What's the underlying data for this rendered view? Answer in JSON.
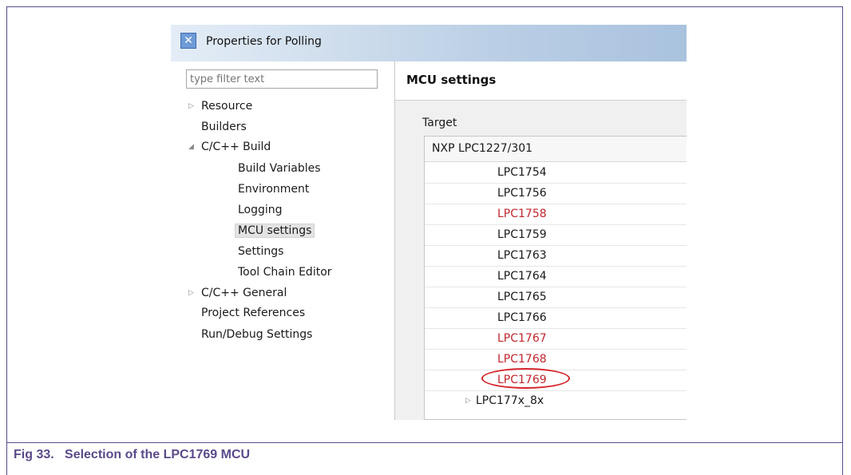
{
  "window": {
    "title": "Properties for Polling",
    "icon": "eclipse-app-icon"
  },
  "filter": {
    "placeholder": "type filter text"
  },
  "tree": {
    "items": [
      {
        "label": "Resource",
        "expander": "collapsed"
      },
      {
        "label": "Builders"
      },
      {
        "label": "C/C++ Build",
        "expander": "expanded"
      },
      {
        "label": "Build Variables"
      },
      {
        "label": "Environment"
      },
      {
        "label": "Logging"
      },
      {
        "label": "MCU settings",
        "selected": true
      },
      {
        "label": "Settings"
      },
      {
        "label": "Tool Chain Editor"
      },
      {
        "label": "C/C++ General",
        "expander": "collapsed"
      },
      {
        "label": "Project References"
      },
      {
        "label": "Run/Debug Settings"
      }
    ]
  },
  "right": {
    "title": "MCU settings",
    "target_label": "Target",
    "list_header": "NXP LPC1227/301",
    "rows": [
      {
        "label": "LPC1754",
        "color": "#1a1a1a"
      },
      {
        "label": "LPC1756",
        "color": "#1a1a1a"
      },
      {
        "label": "LPC1758",
        "color": "#c0272d"
      },
      {
        "label": "LPC1759",
        "color": "#1a1a1a"
      },
      {
        "label": "LPC1763",
        "color": "#1a1a1a"
      },
      {
        "label": "LPC1764",
        "color": "#1a1a1a"
      },
      {
        "label": "LPC1765",
        "color": "#1a1a1a"
      },
      {
        "label": "LPC1766",
        "color": "#1a1a1a"
      },
      {
        "label": "LPC1767",
        "color": "#c0272d"
      },
      {
        "label": "LPC1768",
        "color": "#c0272d"
      },
      {
        "label": "LPC1769",
        "color": "#c0272d",
        "highlighted": true
      },
      {
        "label": "LPC177x_8x",
        "expander": "collapsed"
      }
    ]
  },
  "caption": "Fig 33.   Selection of the LPC1769 MCU",
  "colors": {
    "caption": "#5b4a8a",
    "highlight_circle": "#d6262d",
    "red_item": "#c0272d"
  }
}
